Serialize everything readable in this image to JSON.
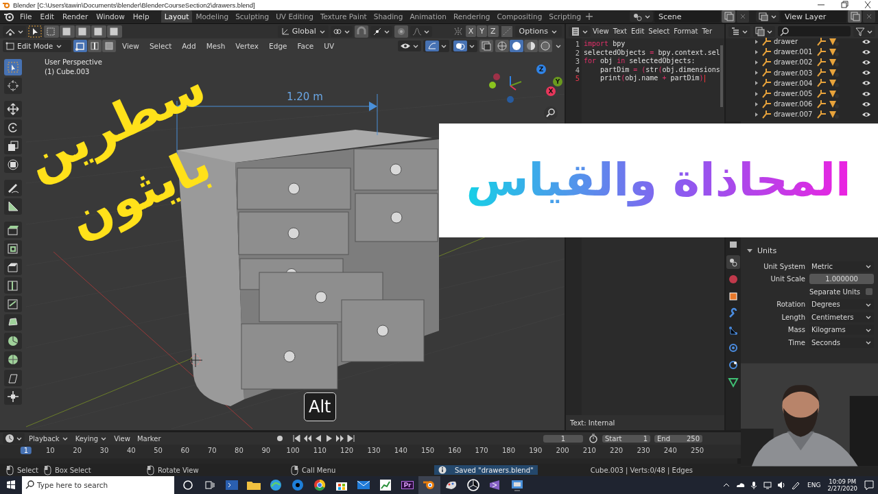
{
  "window": {
    "title": "Blender [C:\\Users\\tawin\\Documents\\blender\\BlenderCourseSection2\\drawers.blend]"
  },
  "menu": [
    "File",
    "Edit",
    "Render",
    "Window",
    "Help"
  ],
  "workspaces": [
    {
      "label": "Layout",
      "selected": true
    },
    {
      "label": "Modeling",
      "selected": false
    },
    {
      "label": "Sculpting",
      "selected": false
    },
    {
      "label": "UV Editing",
      "selected": false
    },
    {
      "label": "Texture Paint",
      "selected": false
    },
    {
      "label": "Shading",
      "selected": false
    },
    {
      "label": "Animation",
      "selected": false
    },
    {
      "label": "Rendering",
      "selected": false
    },
    {
      "label": "Compositing",
      "selected": false
    },
    {
      "label": "Scripting",
      "selected": false
    }
  ],
  "scene": "Scene",
  "view_layer": "View Layer",
  "viewport": {
    "orientation": "Global",
    "axes": [
      "X",
      "Y",
      "Z"
    ],
    "options": "Options",
    "mode": "Edit Mode",
    "select_modes": [
      {
        "selected": true
      },
      {
        "selected": false
      },
      {
        "selected": false
      }
    ],
    "menus": [
      "View",
      "Select",
      "Add",
      "Mesh",
      "Vertex",
      "Edge",
      "Face",
      "UV"
    ],
    "shading_modes": [
      {
        "selected": false
      },
      {
        "selected": true
      },
      {
        "selected": false
      },
      {
        "selected": false
      }
    ],
    "overlay_text": [
      "User Perspective",
      "(1) Cube.003"
    ],
    "dimension": "1.20 m",
    "gizmo": [
      "Z",
      "Y",
      "X"
    ],
    "tools": [
      {
        "selected": true
      },
      {
        "selected": false
      },
      {
        "selected": false
      },
      {
        "selected": false
      },
      {
        "selected": false
      },
      {
        "selected": false
      },
      {
        "selected": false
      },
      {
        "selected": false
      },
      {
        "selected": false
      },
      {
        "selected": false
      },
      {
        "selected": false
      },
      {
        "selected": false
      },
      {
        "selected": false
      },
      {
        "selected": false
      },
      {
        "selected": false
      },
      {
        "selected": false
      },
      {
        "selected": false
      },
      {
        "selected": false
      }
    ]
  },
  "text_editor": {
    "menus": [
      "View",
      "Text",
      "Edit",
      "Select",
      "Format",
      "Ter"
    ],
    "lines": [
      {
        "number": "1",
        "current": false,
        "tokens": [
          {
            "kind": "keyword",
            "text": "import"
          },
          {
            "kind": "plain",
            "text": " bpy"
          }
        ]
      },
      {
        "number": "2",
        "current": false,
        "tokens": [
          {
            "kind": "plain",
            "text": "selectedObjects "
          },
          {
            "kind": "operator",
            "text": "="
          },
          {
            "kind": "plain",
            "text": " bpy.context.sel"
          }
        ]
      },
      {
        "number": "3",
        "current": false,
        "tokens": [
          {
            "kind": "keyword",
            "text": "for"
          },
          {
            "kind": "plain",
            "text": " obj "
          },
          {
            "kind": "keyword",
            "text": "in"
          },
          {
            "kind": "plain",
            "text": " selectedObjects:"
          }
        ]
      },
      {
        "number": "4",
        "current": false,
        "tokens": [
          {
            "kind": "plain",
            "text": "    partDim "
          },
          {
            "kind": "operator",
            "text": "="
          },
          {
            "kind": "operator",
            "text": " ("
          },
          {
            "kind": "plain",
            "text": "str"
          },
          {
            "kind": "operator",
            "text": "("
          },
          {
            "kind": "plain",
            "text": "obj.dimensions"
          }
        ]
      },
      {
        "number": "5",
        "current": true,
        "tokens": [
          {
            "kind": "plain",
            "text": "    print"
          },
          {
            "kind": "operator",
            "text": "("
          },
          {
            "kind": "plain",
            "text": "obj.name "
          },
          {
            "kind": "operator",
            "text": "+"
          },
          {
            "kind": "plain",
            "text": " partDim"
          },
          {
            "kind": "operator",
            "text": ")"
          }
        ]
      }
    ],
    "footer": "Text: Internal"
  },
  "outliner": {
    "items": [
      "drawer",
      "drawer.001",
      "drawer.002",
      "drawer.003",
      "drawer.004",
      "drawer.005",
      "drawer.006",
      "drawer.007"
    ]
  },
  "properties": {
    "section": "Units",
    "expanded": true,
    "rows": [
      {
        "kind": "select",
        "label": "Unit System",
        "value": "Metric"
      },
      {
        "kind": "number",
        "label": "Unit Scale",
        "value": "1.000000"
      },
      {
        "kind": "checkbox",
        "label": "Separate Units",
        "checked": false
      },
      {
        "kind": "select",
        "label": "Rotation",
        "value": "Degrees"
      },
      {
        "kind": "select",
        "label": "Length",
        "value": "Centimeters"
      },
      {
        "kind": "select",
        "label": "Mass",
        "value": "Kilograms"
      },
      {
        "kind": "select",
        "label": "Time",
        "value": "Seconds"
      }
    ]
  },
  "timeline": {
    "menus": [
      "Playback",
      "Keying",
      "View",
      "Marker"
    ],
    "current_frame": "1",
    "start_label": "Start",
    "start": "1",
    "end_label": "End",
    "end": "250",
    "ticks": [
      {
        "label": "1",
        "selected": true
      },
      {
        "label": "10",
        "selected": false
      },
      {
        "label": "20",
        "selected": false
      },
      {
        "label": "30",
        "selected": false
      },
      {
        "label": "40",
        "selected": false
      },
      {
        "label": "50",
        "selected": false
      },
      {
        "label": "60",
        "selected": false
      },
      {
        "label": "70",
        "selected": false
      },
      {
        "label": "80",
        "selected": false
      },
      {
        "label": "90",
        "selected": false
      },
      {
        "label": "100",
        "selected": false
      },
      {
        "label": "110",
        "selected": false
      },
      {
        "label": "120",
        "selected": false
      },
      {
        "label": "130",
        "selected": false
      },
      {
        "label": "140",
        "selected": false
      },
      {
        "label": "150",
        "selected": false
      },
      {
        "label": "160",
        "selected": false
      },
      {
        "label": "170",
        "selected": false
      },
      {
        "label": "180",
        "selected": false
      },
      {
        "label": "190",
        "selected": false
      },
      {
        "label": "200",
        "selected": false
      },
      {
        "label": "210",
        "selected": false
      },
      {
        "label": "220",
        "selected": false
      },
      {
        "label": "230",
        "selected": false
      },
      {
        "label": "240",
        "selected": false
      },
      {
        "label": "250",
        "selected": false
      }
    ]
  },
  "status_bar": {
    "hints": [
      "Select",
      "Box Select",
      "Rotate View",
      "Call Menu"
    ],
    "message": "Saved \"drawers.blend\"",
    "stats": "Cube.003 | Verts:0/48 | Edges"
  },
  "taskbar": {
    "search": {
      "placeholder": "Type here to search"
    },
    "app_badge": "Pr",
    "language": "ENG",
    "time": "10:09 PM",
    "date": "2/27/2020"
  },
  "overlay": {
    "title_lines": [
      "سطرين",
      "بايثون"
    ],
    "banner": "المحاذاة والقياس",
    "key_hint": "Alt",
    "webcam": {
      "kind": "picture"
    }
  }
}
